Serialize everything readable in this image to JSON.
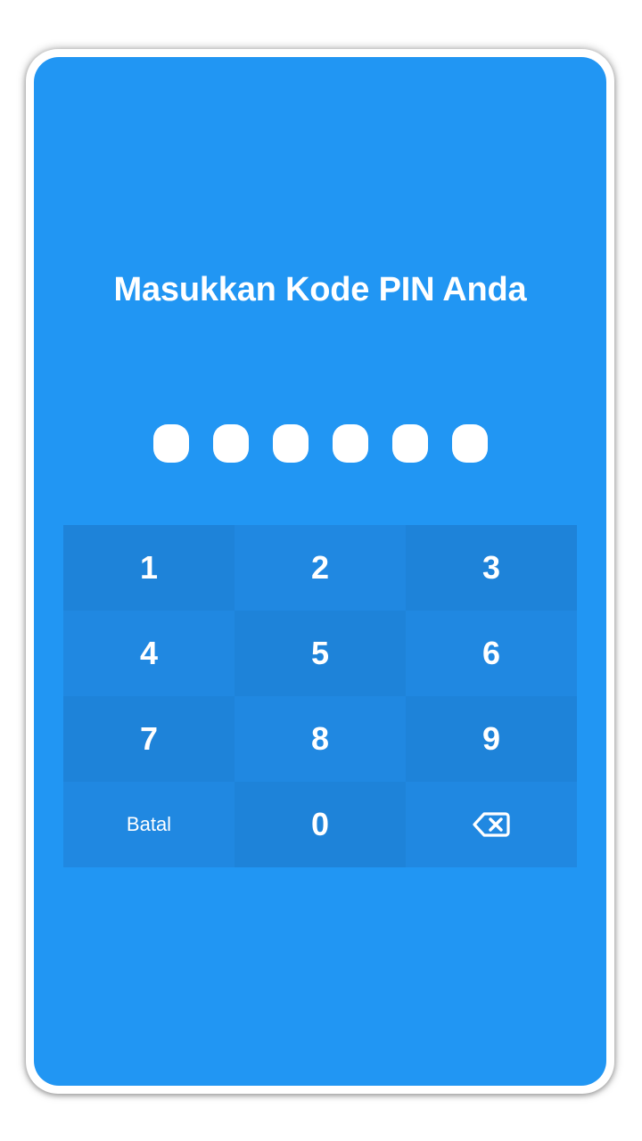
{
  "pin_screen": {
    "title": "Masukkan Kode PIN Anda",
    "pin_length": 6,
    "filled_digits": 6
  },
  "keypad": {
    "keys": [
      "1",
      "2",
      "3",
      "4",
      "5",
      "6",
      "7",
      "8",
      "9"
    ],
    "cancel_label": "Batal",
    "zero_label": "0",
    "backspace_icon": "backspace-icon"
  },
  "colors": {
    "background": "#2196f3",
    "key_dark": "#1e83d9",
    "key_light": "#2088e1",
    "text": "#ffffff"
  }
}
